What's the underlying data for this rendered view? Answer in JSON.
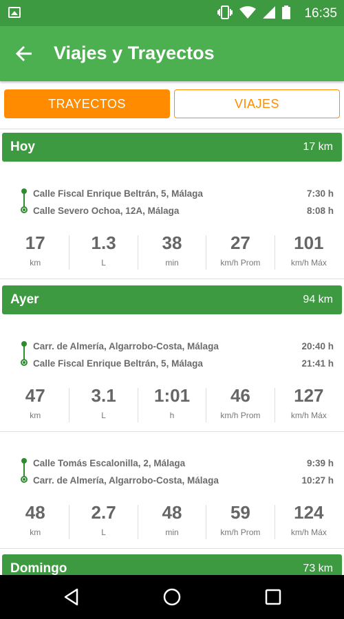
{
  "status_bar": {
    "time": "16:35",
    "icons": [
      "image-icon",
      "vibrate-icon",
      "wifi-icon",
      "signal-icon",
      "battery-icon"
    ]
  },
  "app_bar": {
    "title": "Viajes y Trayectos",
    "back_icon": "arrow-left-icon"
  },
  "tabs": [
    {
      "label": "TRAYECTOS",
      "active": true
    },
    {
      "label": "VIAJES",
      "active": false
    }
  ],
  "sections": [
    {
      "day": "Hoy",
      "distance": "17 km",
      "trips": [
        {
          "from": "Calle Fiscal Enrique Beltrán, 5, Málaga",
          "from_time": "7:30 h",
          "to": "Calle Severo Ochoa, 12A, Málaga",
          "to_time": "8:08 h",
          "stats": [
            {
              "value": "17",
              "unit": "km"
            },
            {
              "value": "1.3",
              "unit": "L"
            },
            {
              "value": "38",
              "unit": "min"
            },
            {
              "value": "27",
              "unit": "km/h Prom"
            },
            {
              "value": "101",
              "unit": "km/h Máx"
            }
          ]
        }
      ]
    },
    {
      "day": "Ayer",
      "distance": "94 km",
      "trips": [
        {
          "from": "Carr. de Almería, Algarrobo-Costa, Málaga",
          "from_time": "20:40 h",
          "to": "Calle Fiscal Enrique Beltrán, 5, Málaga",
          "to_time": "21:41 h",
          "stats": [
            {
              "value": "47",
              "unit": "km"
            },
            {
              "value": "3.1",
              "unit": "L"
            },
            {
              "value": "1:01",
              "unit": "h"
            },
            {
              "value": "46",
              "unit": "km/h Prom"
            },
            {
              "value": "127",
              "unit": "km/h Máx"
            }
          ]
        },
        {
          "from": "Calle Tomás Escalonilla, 2, Málaga",
          "from_time": "9:39 h",
          "to": "Carr. de Almería, Algarrobo-Costa, Málaga",
          "to_time": "10:27 h",
          "stats": [
            {
              "value": "48",
              "unit": "km"
            },
            {
              "value": "2.7",
              "unit": "L"
            },
            {
              "value": "48",
              "unit": "min"
            },
            {
              "value": "59",
              "unit": "km/h Prom"
            },
            {
              "value": "124",
              "unit": "km/h Máx"
            }
          ]
        }
      ]
    },
    {
      "day": "Domingo",
      "distance": "73 km",
      "trips": []
    }
  ],
  "colors": {
    "header_green": "#3e9a41",
    "appbar_green": "#4caf50",
    "accent_orange": "#ff8c00"
  }
}
